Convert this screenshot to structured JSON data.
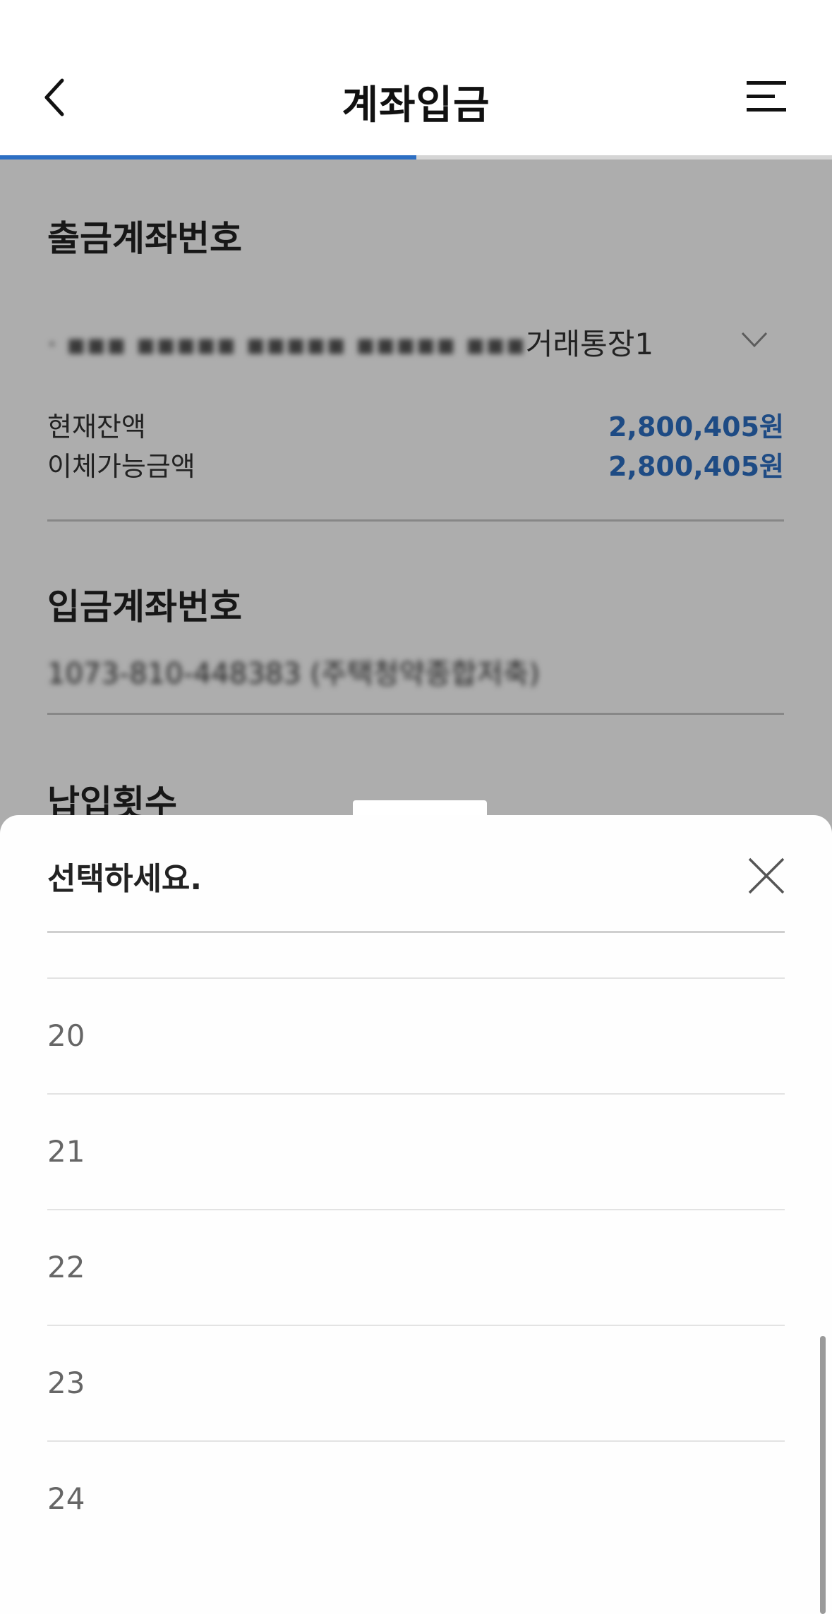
{
  "header": {
    "title": "계좌입금",
    "progress_fraction": 0.5
  },
  "withdraw": {
    "title": "출금계좌번호",
    "account_masked": "·  ▪▪▪  ▪▪▪▪▪  ▪▪▪▪▪  ▪▪▪▪▪  ▪▪▪",
    "account_suffix": "거래통장1",
    "balance_label": "현재잔액",
    "balance_value": "2,800,405원",
    "available_label": "이체가능금액",
    "available_value": "2,800,405원"
  },
  "deposit": {
    "title": "입금계좌번호",
    "account_masked": "1073-810-448383 (주택청약종합저축)"
  },
  "payments": {
    "title": "납입횟수"
  },
  "sheet": {
    "title": "선택하세요.",
    "options": [
      "20",
      "21",
      "22",
      "23",
      "24"
    ]
  },
  "icons": {
    "back": "chevron-left-icon",
    "menu": "hamburger-menu-icon",
    "dropdown": "chevron-down-icon",
    "close": "close-icon"
  },
  "colors": {
    "accent": "#2d6fc3",
    "overlay": "rgba(0,0,0,0.32)"
  }
}
